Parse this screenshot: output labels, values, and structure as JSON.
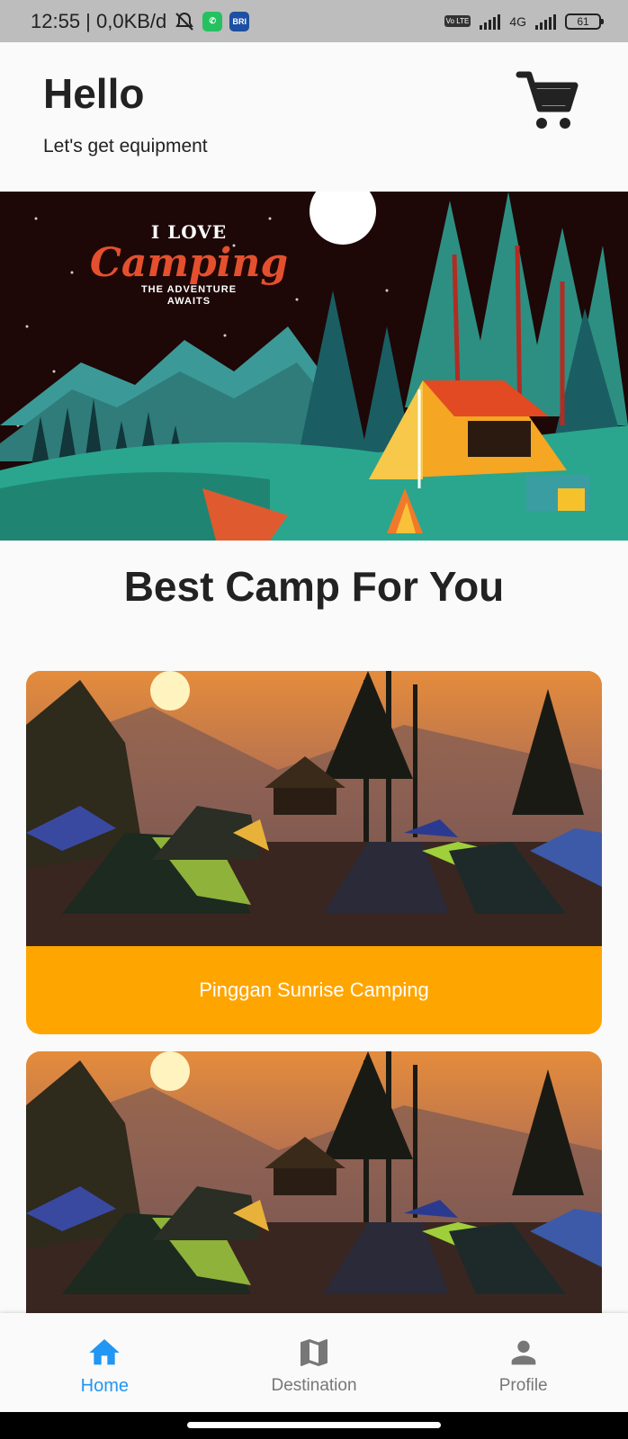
{
  "status_bar": {
    "time_data": "12:55 | 0,0KB/d",
    "network": "4G",
    "volte": "Vo LTE",
    "battery": "61",
    "apps": {
      "whatsapp": "whatsapp-icon",
      "bri": "BRI"
    }
  },
  "header": {
    "title": "Hello",
    "subtitle": "Let's get equipment",
    "cart_icon": "cart-icon"
  },
  "banner": {
    "line1": "I LOVE",
    "line2": "Camping",
    "line3": "THE ADVENTURE",
    "line4": "AWAITS"
  },
  "section": {
    "title": "Best Camp For You"
  },
  "cards": [
    {
      "label": "Pinggan Sunrise Camping"
    },
    {
      "label": ""
    }
  ],
  "nav": {
    "items": [
      {
        "label": "Home",
        "icon": "home-icon",
        "active": true
      },
      {
        "label": "Destination",
        "icon": "map-icon",
        "active": false
      },
      {
        "label": "Profile",
        "icon": "person-icon",
        "active": false
      }
    ]
  },
  "colors": {
    "accent": "#ffa500",
    "nav_active": "#2196f3",
    "nav_inactive": "#777777",
    "banner_bg": "#1e0707"
  }
}
